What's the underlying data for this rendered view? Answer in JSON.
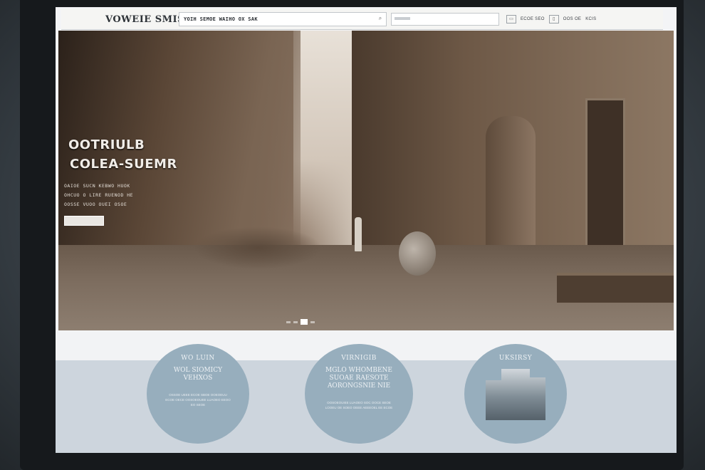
{
  "nav": {
    "logo": "VOWEIE SMIS",
    "search_value": "YOIH SEMOE WAIHO OX SAK",
    "links": [
      "ECOE SEO",
      "OOS OE",
      "KCIS"
    ]
  },
  "hero": {
    "title_line_1": "OOTRIULB",
    "title_line_2": "COLEA-SUEMR",
    "sub_lines": [
      "OAIOE SUCN KEBWO HUOK",
      "OHCUO O LIRE RUENOD HE",
      "OOSSE VUOO OUEI OSOE"
    ]
  },
  "cards": [
    {
      "title": "WO LUIN",
      "sub": "WOL SIOMICY VEHXOS",
      "body": "OSSOE UEEE ECOE SBOE OOEOEUU ECOE OECE OOSOEOUEE LUAOEO EEOO EO SEOE"
    },
    {
      "title": "VIRNIGIB",
      "sub": "MGLO WHOMBENE SUOAE RAESOTE AORONGSNIE NIE",
      "body": "OOSOEOUIEE LUAOEO SOC OOCE SEOE LOOEU OE SOEO OEEE AEEEOEL EE ECOE"
    },
    {
      "title": "UKSIRSY",
      "sub": "",
      "body": ""
    }
  ]
}
